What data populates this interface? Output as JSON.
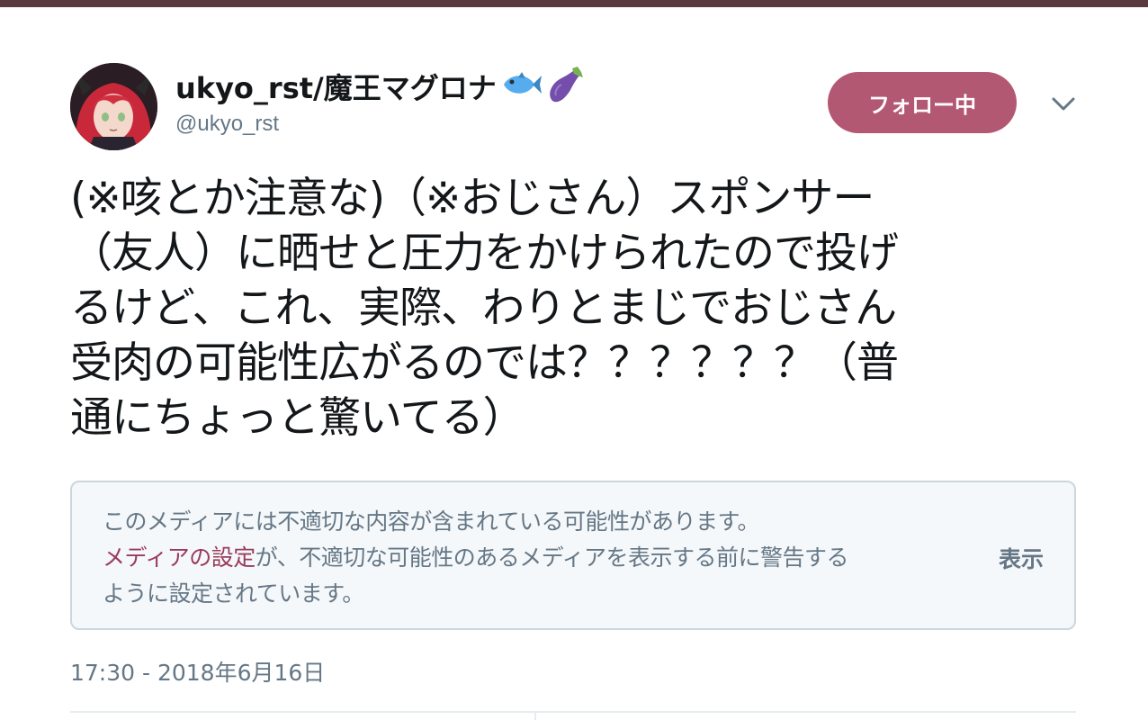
{
  "author": {
    "display_name": "ukyo_rst/魔王マグロナ",
    "handle": "@ukyo_rst",
    "emojis": [
      "fish-icon",
      "eggplant-icon"
    ]
  },
  "follow_button": {
    "label": "フォロー中",
    "color": "#b35872"
  },
  "tweet": {
    "lines": [
      "(※咳とか注意な)（※おじさん）スポンサー",
      "（友人）に晒せと圧力をかけられたので投げ",
      "るけど、これ、実際、わりとまじでおじさん",
      "受肉の可能性広がるのでは？？？？？？（普",
      "通にちょっと驚いてる）"
    ]
  },
  "media_warning": {
    "line1": "このメディアには不適切な内容が含まれている可能性があります。",
    "link": "メディアの設定",
    "line2_rest": "が、不適切な可能性のあるメディアを表示する前に警告する",
    "line3": "ように設定されています。",
    "show_label": "表示"
  },
  "timestamp": "17:30 - 2018年6月16日",
  "colors": {
    "accent": "#b35872",
    "link": "#9a3b5a",
    "secondary_text": "#657786"
  }
}
